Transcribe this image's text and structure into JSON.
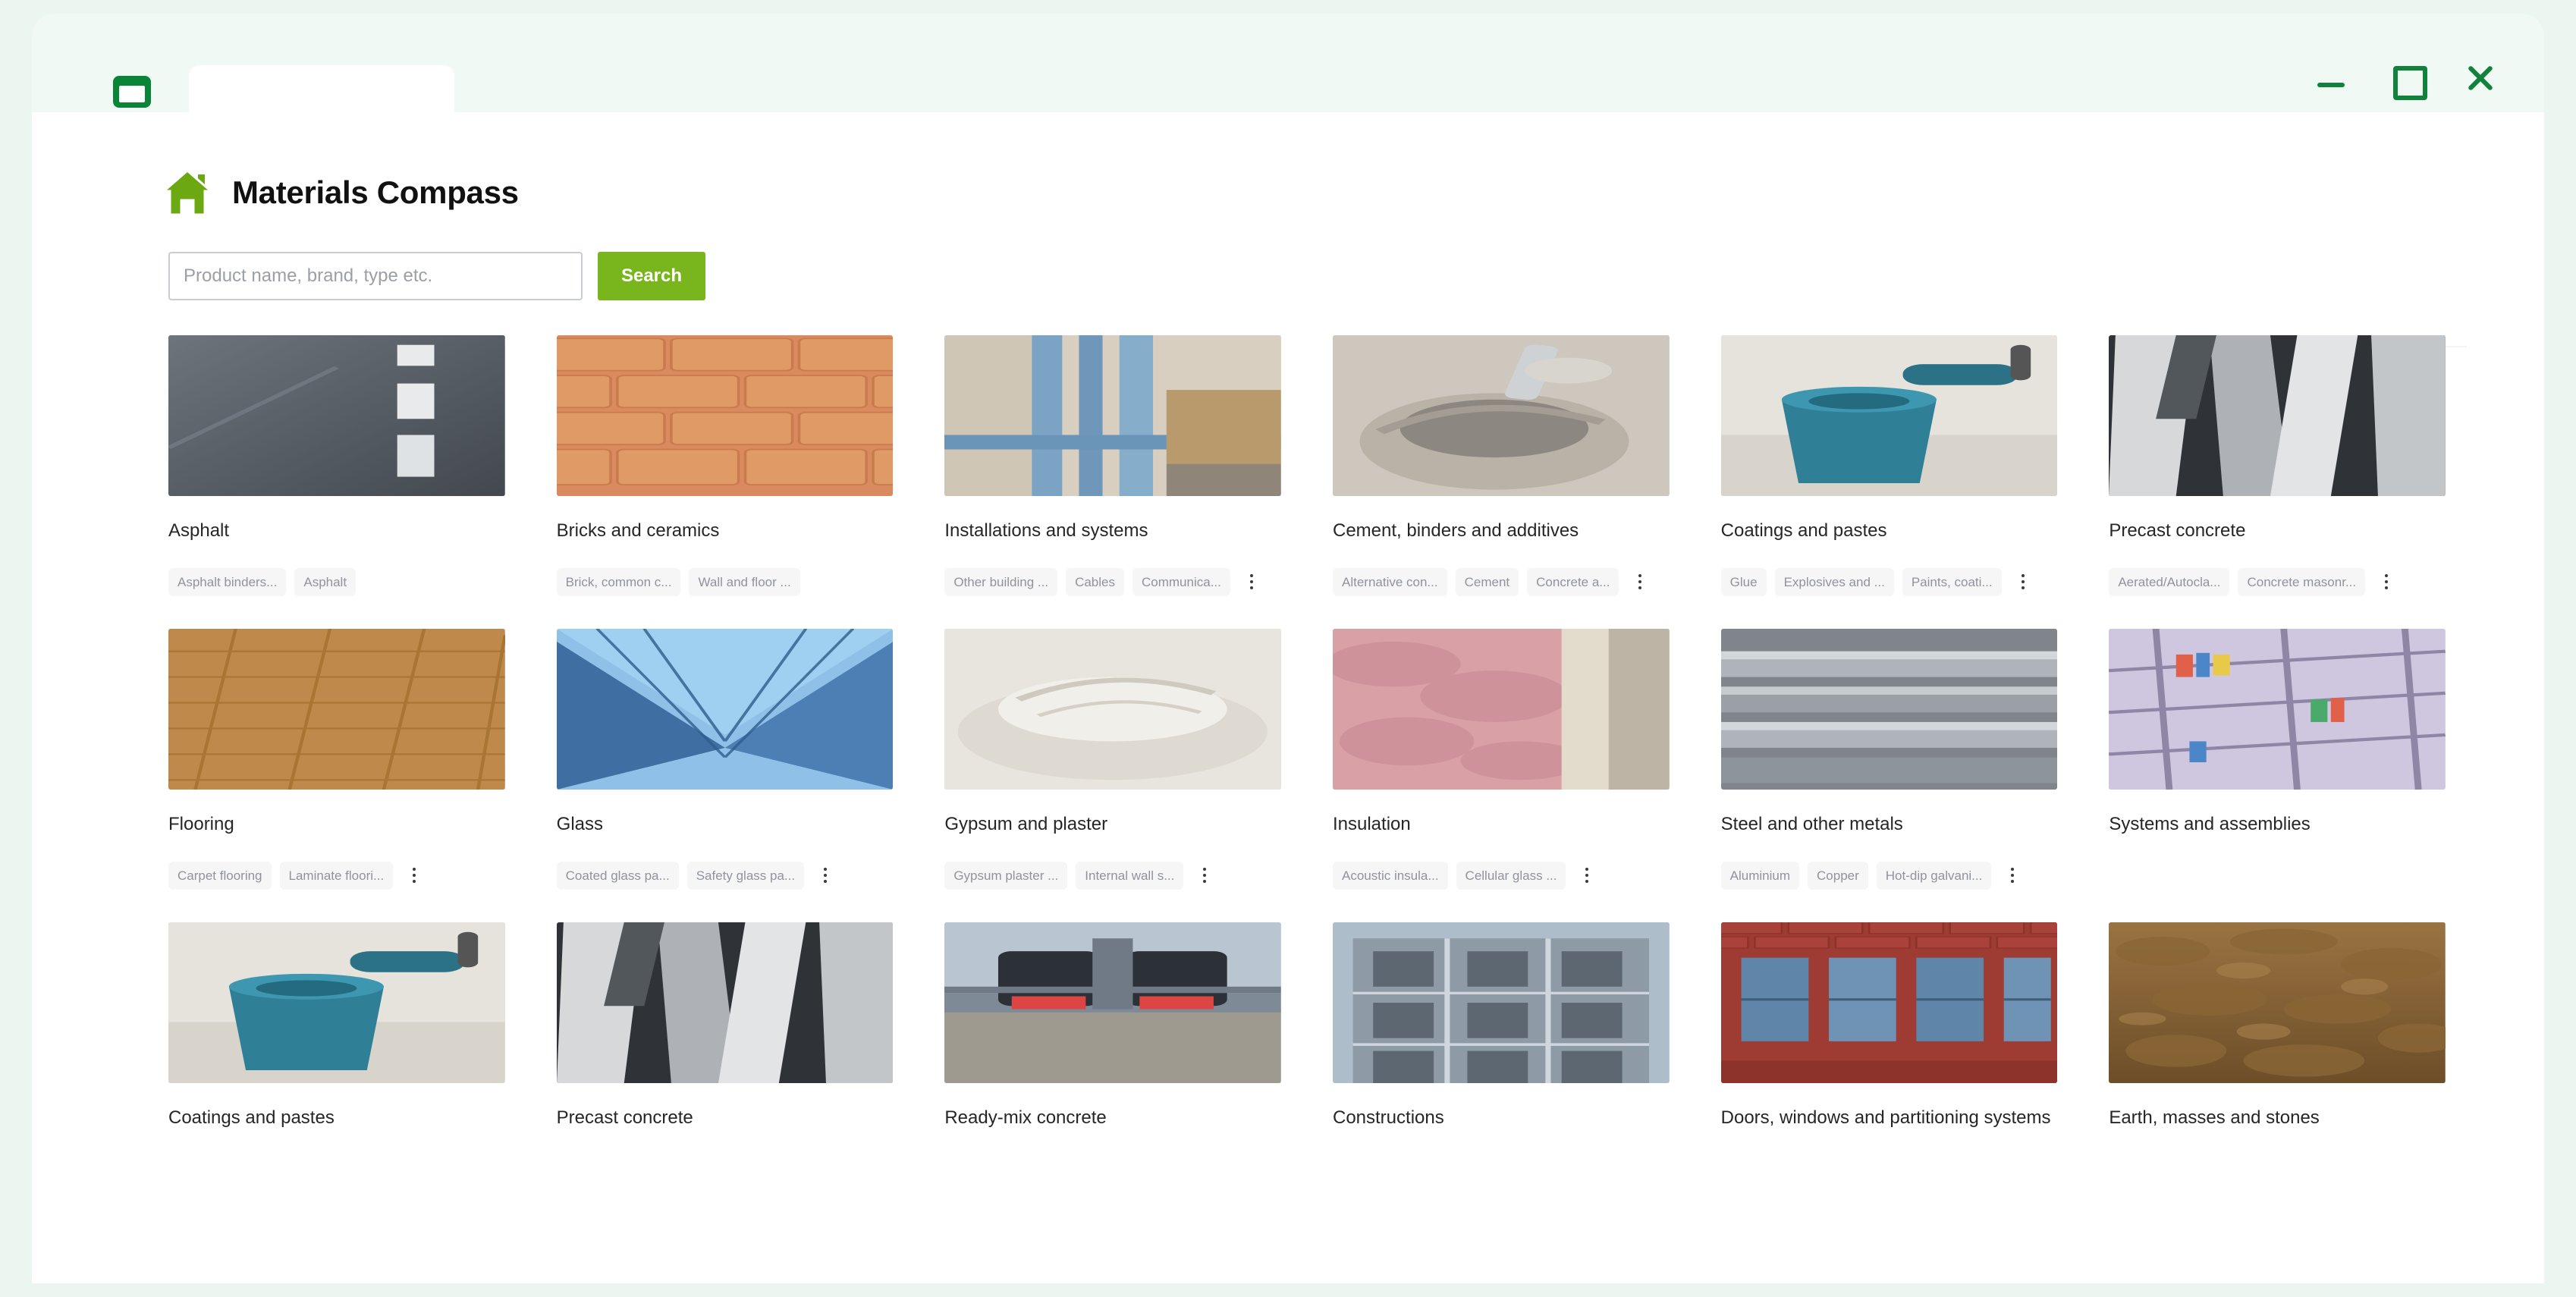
{
  "window": {
    "app_icon": "window-icon",
    "tab_label": "",
    "controls": {
      "minimize": "minimize-icon",
      "maximize": "maximize-icon",
      "close": "close-icon"
    }
  },
  "header": {
    "logo_icon": "home-icon",
    "title": "Materials Compass",
    "accent_green": "#79b61d",
    "brand_green": "#0a8537"
  },
  "search": {
    "placeholder": "Product name, brand, type etc.",
    "value": "",
    "button_label": "Search"
  },
  "overflow_icon": "more-vertical-icon",
  "categories": [
    {
      "title": "Asphalt",
      "image": "asphalt-road-photo",
      "tags": [
        "Asphalt binders...",
        "Asphalt"
      ],
      "has_more": false
    },
    {
      "title": "Bricks and ceramics",
      "image": "red-bricks-photo",
      "tags": [
        "Brick, common c...",
        "Wall and floor ..."
      ],
      "has_more": false
    },
    {
      "title": "Installations and systems",
      "image": "pipes-installation-photo",
      "tags": [
        "Other building ...",
        "Cables",
        "Communica..."
      ],
      "has_more": true
    },
    {
      "title": "Cement, binders and additives",
      "image": "cement-bag-trowel-photo",
      "tags": [
        "Alternative con...",
        "Cement",
        "Concrete a..."
      ],
      "has_more": true
    },
    {
      "title": "Coatings and pastes",
      "image": "paint-roller-bucket-photo",
      "tags": [
        "Glue",
        "Explosives and ...",
        "Paints, coati..."
      ],
      "has_more": true
    },
    {
      "title": "Precast concrete",
      "image": "precast-concrete-slabs-photo",
      "tags": [
        "Aerated/Autocla...",
        "Concrete masonr..."
      ],
      "has_more": true
    },
    {
      "title": "Flooring",
      "image": "wood-parquet-floor-photo",
      "tags": [
        "Carpet flooring",
        "Laminate floori..."
      ],
      "has_more": true
    },
    {
      "title": "Glass",
      "image": "glass-facade-photo",
      "tags": [
        "Coated glass pa...",
        "Safety glass pa..."
      ],
      "has_more": true
    },
    {
      "title": "Gypsum and plaster",
      "image": "gypsum-powder-photo",
      "tags": [
        "Gypsum plaster ...",
        "Internal wall s..."
      ],
      "has_more": true
    },
    {
      "title": "Insulation",
      "image": "mineral-wool-insulation-photo",
      "tags": [
        "Acoustic insula...",
        "Cellular glass ..."
      ],
      "has_more": true
    },
    {
      "title": "Steel and other metals",
      "image": "steel-pipes-photo",
      "tags": [
        "Aluminium",
        "Copper",
        "Hot-dip galvani..."
      ],
      "has_more": true
    },
    {
      "title": "Systems and assemblies",
      "image": "shelving-system-photo",
      "tags": [],
      "has_more": false
    },
    {
      "title": "Coatings and pastes",
      "image": "paint-roller-bucket-photo",
      "tags": [],
      "has_more": false
    },
    {
      "title": "Precast concrete",
      "image": "precast-concrete-slabs-photo",
      "tags": [],
      "has_more": false
    },
    {
      "title": "Ready-mix concrete",
      "image": "concrete-mixer-truck-photo",
      "tags": [],
      "has_more": false
    },
    {
      "title": "Constructions",
      "image": "building-scaffolding-photo",
      "tags": [],
      "has_more": false
    },
    {
      "title": "Doors, windows and partitioning systems",
      "image": "brick-building-windows-photo",
      "tags": [],
      "has_more": false
    },
    {
      "title": "Earth, masses and stones",
      "image": "soil-earth-photo",
      "tags": [],
      "has_more": false
    }
  ]
}
